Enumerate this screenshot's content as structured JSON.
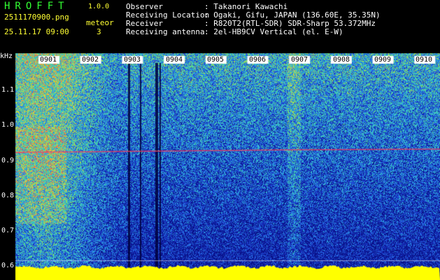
{
  "header": {
    "brand": "HROFFT",
    "version": "1.0.0",
    "filename": "2511170900.png",
    "datetime": "25.11.17 09:00",
    "meteor_label": "meteor",
    "meteor_count": "3"
  },
  "meta": [
    {
      "label": "Observer",
      "value": ": Takanori Kawachi"
    },
    {
      "label": "Receiving Location",
      "value": ": Ogaki, Gifu, JAPAN (136.60E, 35.35N)"
    },
    {
      "label": "Receiver",
      "value": ": R820T2(RTL-SDR) SDR-Sharp 53.372MHz"
    },
    {
      "label": "Receiving antenna",
      "value": ": 2el-HB9CV Vertical (el. E-W)"
    }
  ],
  "axis": {
    "y_unit": "kHz",
    "y_ticks": [
      "1.1",
      "1.0",
      "0.9",
      "0.8",
      "0.7",
      "0.6"
    ],
    "x_ticks": [
      "0901",
      "0902",
      "0903",
      "0904",
      "0905",
      "0906",
      "0907",
      "0908",
      "0909",
      "0910"
    ]
  },
  "colors": {
    "header_green": "#33ff33",
    "header_yellow": "#ffff33",
    "noise_floor": "#ffff00",
    "background": "#000000"
  }
}
